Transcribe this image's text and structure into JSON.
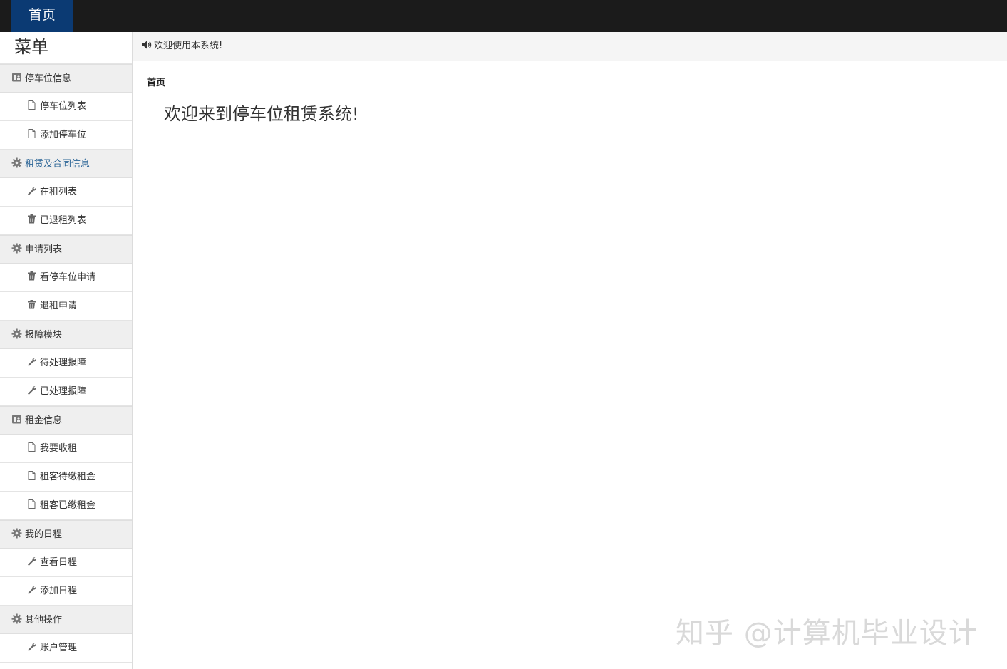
{
  "topbar": {
    "home_label": "首页"
  },
  "sidebar": {
    "title": "菜单",
    "groups": [
      {
        "label": "停车位信息",
        "icon": "address-card-icon",
        "items": [
          {
            "label": "停车位列表",
            "icon": "file-icon"
          },
          {
            "label": "添加停车位",
            "icon": "file-icon"
          }
        ]
      },
      {
        "label": "租赁及合同信息",
        "icon": "gear-icon",
        "items": [
          {
            "label": "在租列表",
            "icon": "wrench-icon"
          },
          {
            "label": "已退租列表",
            "icon": "trash-icon"
          }
        ]
      },
      {
        "label": "申请列表",
        "icon": "gear-icon",
        "items": [
          {
            "label": "看停车位申请",
            "icon": "trash-icon"
          },
          {
            "label": "退租申请",
            "icon": "trash-icon"
          }
        ]
      },
      {
        "label": "报障模块",
        "icon": "gear-icon",
        "items": [
          {
            "label": "待处理报障",
            "icon": "wrench-icon"
          },
          {
            "label": "已处理报障",
            "icon": "wrench-icon"
          }
        ]
      },
      {
        "label": "租金信息",
        "icon": "address-card-icon",
        "items": [
          {
            "label": "我要收租",
            "icon": "file-icon"
          },
          {
            "label": "租客待缴租金",
            "icon": "file-icon"
          },
          {
            "label": "租客已缴租金",
            "icon": "file-icon"
          }
        ]
      },
      {
        "label": "我的日程",
        "icon": "gear-icon",
        "items": [
          {
            "label": "查看日程",
            "icon": "wrench-icon"
          },
          {
            "label": "添加日程",
            "icon": "wrench-icon"
          }
        ]
      },
      {
        "label": "其他操作",
        "icon": "gear-icon",
        "items": [
          {
            "label": "账户管理",
            "icon": "wrench-icon"
          }
        ]
      }
    ]
  },
  "notice": {
    "text": "欢迎使用本系统!",
    "icon": "volume-icon"
  },
  "main": {
    "breadcrumb": "首页",
    "welcome": "欢迎来到停车位租赁系统!"
  },
  "watermark": "知乎 @计算机毕业设计",
  "colors": {
    "topbar": "#1b1b1b",
    "home_tab": "#0b3a73",
    "active_group": "#2a6496"
  }
}
